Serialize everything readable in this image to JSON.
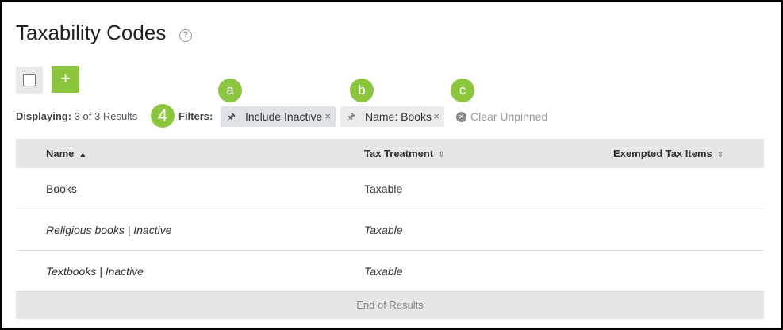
{
  "page": {
    "title": "Taxability Codes",
    "help_icon": "?"
  },
  "toolbar": {
    "add_label": "+"
  },
  "markers": {
    "a": "a",
    "b": "b",
    "c": "c",
    "four": "4"
  },
  "results": {
    "displaying_label": "Displaying:",
    "displaying_value": "3 of 3 Results"
  },
  "filters": {
    "label": "Filters:",
    "chips": [
      {
        "label": "Include Inactive",
        "pinned": true,
        "remove": "×"
      },
      {
        "label": "Name: Books",
        "pinned": false,
        "remove": "×"
      }
    ],
    "clear_label": "Clear Unpinned",
    "clear_icon": "×"
  },
  "table": {
    "columns": [
      {
        "label": "Name",
        "sort": "▲"
      },
      {
        "label": "Tax Treatment",
        "sort": "⇕"
      },
      {
        "label": "Exempted Tax Items",
        "sort": "⇕"
      }
    ],
    "rows": [
      {
        "name": "Books",
        "tax_treatment": "Taxable",
        "exempted": ""
      },
      {
        "name": "Religious books | Inactive",
        "tax_treatment": "Taxable",
        "exempted": ""
      },
      {
        "name": "Textbooks | Inactive",
        "tax_treatment": "Taxable",
        "exempted": ""
      }
    ],
    "footer": "End of Results"
  },
  "colors": {
    "accent": "#8cc63f",
    "header_bg": "#e6e6e6"
  }
}
